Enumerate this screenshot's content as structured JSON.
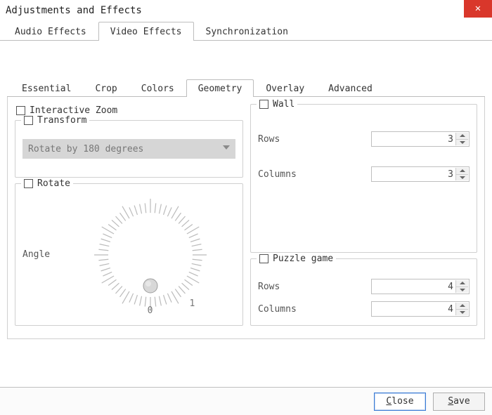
{
  "window": {
    "title": "Adjustments and Effects"
  },
  "tabs": {
    "main": [
      "Audio Effects",
      "Video Effects",
      "Synchronization"
    ],
    "main_active": 1,
    "sub": [
      "Essential",
      "Crop",
      "Colors",
      "Geometry",
      "Overlay",
      "Advanced"
    ],
    "sub_active": 3
  },
  "geometry": {
    "interactive_zoom_label": "Interactive Zoom",
    "transform": {
      "label": "Transform",
      "combo_value": "Rotate by 180 degrees"
    },
    "rotate": {
      "label": "Rotate",
      "angle_label": "Angle",
      "scale_min": "0",
      "scale_max": "1"
    },
    "wall": {
      "label": "Wall",
      "rows_label": "Rows",
      "rows_value": "3",
      "cols_label": "Columns",
      "cols_value": "3"
    },
    "puzzle": {
      "label": "Puzzle game",
      "rows_label": "Rows",
      "rows_value": "4",
      "cols_label": "Columns",
      "cols_value": "4"
    }
  },
  "buttons": {
    "close": "Close",
    "save": "Save"
  }
}
